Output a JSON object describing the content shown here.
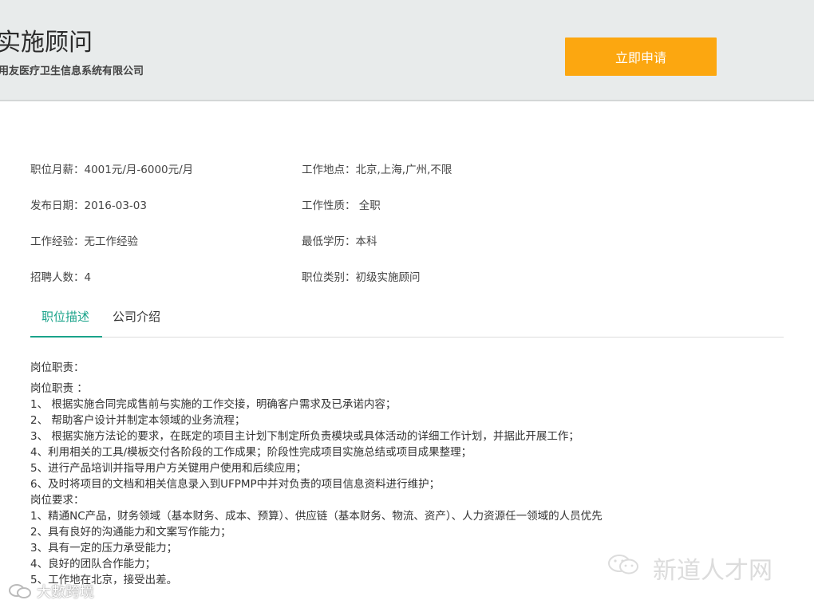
{
  "header": {
    "job_title": "实施顾问",
    "company": "用友医疗卫生信息系统有限公司",
    "apply_label": "立即申请",
    "apply_color": "#fca710"
  },
  "info": {
    "salary": "职位月薪：4001元/月-6000元/月",
    "location": "工作地点：北京,上海,广州,不限",
    "publish_date": "发布日期：2016-03-03",
    "job_type": "工作性质： 全职",
    "experience": "工作经验：无工作经验",
    "education": "最低学历：本科",
    "headcount": "招聘人数：4",
    "category": "职位类别：初级实施顾问"
  },
  "tabs": [
    {
      "label": "职位描述",
      "active": true
    },
    {
      "label": "公司介绍",
      "active": false
    }
  ],
  "accent_color": "#1aa38a",
  "description": {
    "heading": "岗位职责：",
    "lines": [
      "岗位职责 ：",
      "1、 根据实施合同完成售前与实施的工作交接，明确客户需求及已承诺内容；",
      "2、 帮助客户设计并制定本领域的业务流程；",
      "3、 根据实施方法论的要求，在既定的项目主计划下制定所负责模块或具体活动的详细工作计划，并据此开展工作；",
      "4、利用相关的工具/模板交付各阶段的工作成果；阶段性完成项目实施总结或项目成果整理；",
      "5、进行产品培训并指导用户方关键用户使用和后续应用；",
      "6、及时将项目的文档和相关信息录入到UFPMP中并对负责的项目信息资料进行维护；",
      "岗位要求：",
      "1、精通NC产品，财务领域（基本财务、成本、预算）、供应链（基本财务、物流、资产）、人力资源任一领域的人员优先",
      "2、具有良好的沟通能力和文案写作能力；",
      "3、具有一定的压力承受能力；",
      "4、良好的团队合作能力；",
      "5、工作地在北京，接受出差。"
    ]
  },
  "watermarks": {
    "right": "新道人才网",
    "left": "大數跨境"
  }
}
